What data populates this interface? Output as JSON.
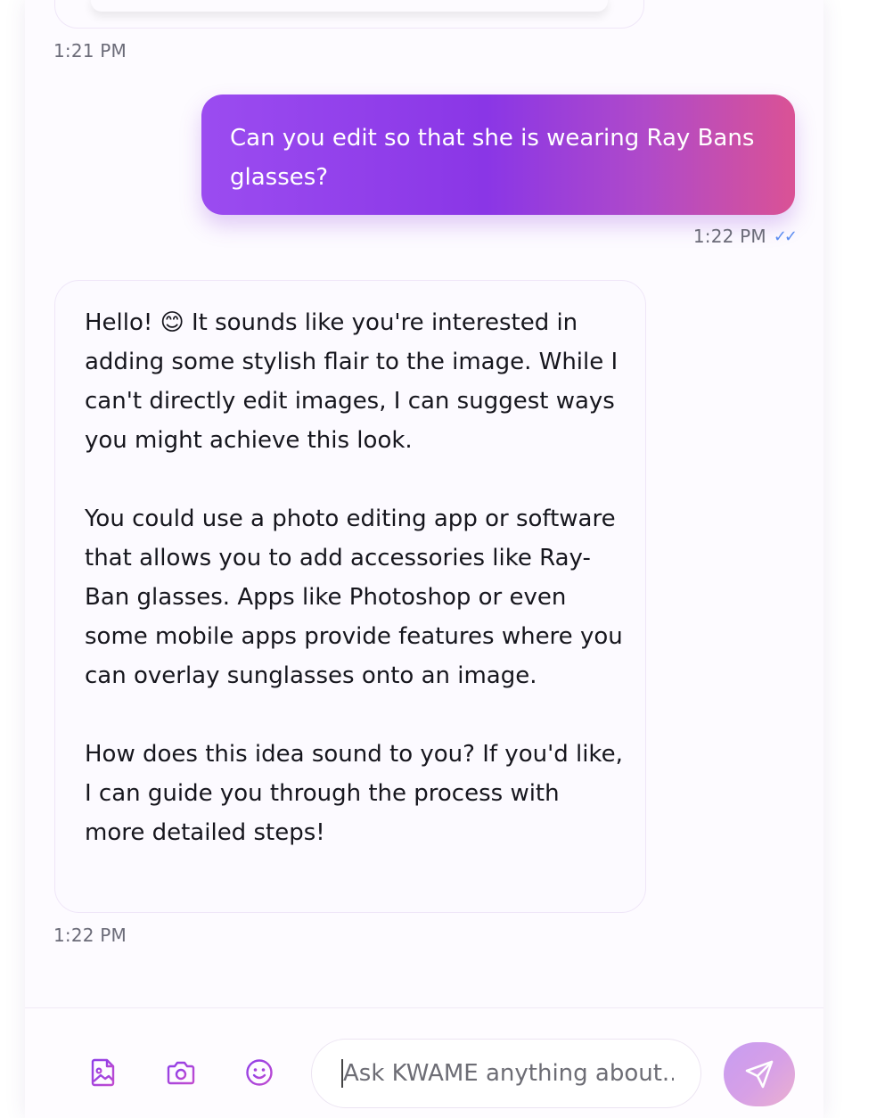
{
  "messages": {
    "prev_time": "1:21 PM",
    "user_text": "Can you edit so that she is wearing Ray Bans glasses?",
    "user_time": "1:22 PM",
    "read_ticks": "✓✓",
    "bot_text": "Hello! 😊 It sounds like you're interested in adding some stylish flair to the image. While I can't directly edit images, I can suggest ways you might achieve this look.\n\nYou could use a photo editing app or software that allows you to add accessories like Ray-Ban glasses. Apps like Photoshop or even some mobile apps provide features where you can overlay sunglasses onto an image.\n\nHow does this idea sound to you? If you'd like, I can guide you through the process with more detailed steps!",
    "bot_time": "1:22 PM"
  },
  "composer": {
    "placeholder": "Ask KWAME anything about...",
    "icons": [
      "image-upload-icon",
      "camera-icon",
      "emoji-icon",
      "send-icon"
    ]
  },
  "colors": {
    "accent": "#8a36e6",
    "gradient_end": "#da5295",
    "tick": "#5b8cf0"
  }
}
